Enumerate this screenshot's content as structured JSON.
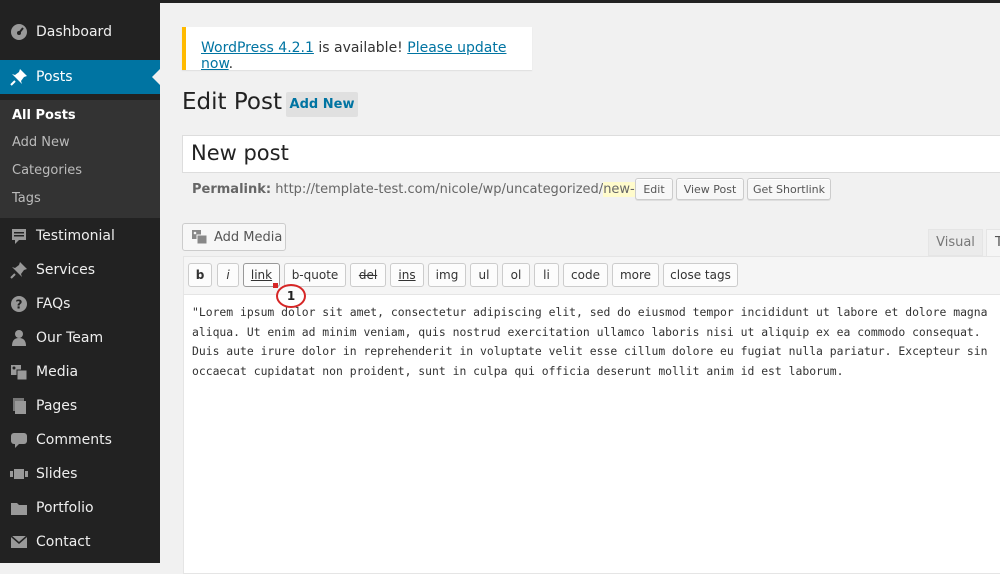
{
  "sidebar": {
    "items": [
      {
        "label": "Dashboard",
        "icon": "dashboard-icon"
      },
      {
        "label": "Posts",
        "icon": "pin-icon",
        "active": true
      },
      {
        "label": "Testimonial",
        "icon": "comment-alt-icon"
      },
      {
        "label": "Services",
        "icon": "pin-icon"
      },
      {
        "label": "FAQs",
        "icon": "help-icon"
      },
      {
        "label": "Our Team",
        "icon": "person-icon"
      },
      {
        "label": "Media",
        "icon": "media-icon"
      },
      {
        "label": "Pages",
        "icon": "pages-icon"
      },
      {
        "label": "Comments",
        "icon": "comment-icon"
      },
      {
        "label": "Slides",
        "icon": "slides-icon"
      },
      {
        "label": "Portfolio",
        "icon": "folder-icon"
      },
      {
        "label": "Contact",
        "icon": "mail-icon"
      }
    ],
    "submenu": [
      "All Posts",
      "Add New",
      "Categories",
      "Tags"
    ]
  },
  "notice": {
    "link1": "WordPress 4.2.1",
    "middle": " is available! ",
    "link2": "Please update now",
    "end": "."
  },
  "page": {
    "title": "Edit Post",
    "add_new": "Add New"
  },
  "post": {
    "title": "New post",
    "permalink_label": "Permalink:",
    "permalink_base": " http://template-test.com/nicole/wp/uncategorized/",
    "permalink_slug": "new-post",
    "permalink_end": "/",
    "edit_btn": "Edit",
    "view_btn": "View Post",
    "shortlink_btn": "Get Shortlink"
  },
  "editor": {
    "add_media": "Add Media",
    "tab_visual": "Visual",
    "tab_text": "T",
    "quicktags": [
      "b",
      "i",
      "link",
      "b-quote",
      "del",
      "ins",
      "img",
      "ul",
      "ol",
      "li",
      "code",
      "more",
      "close tags"
    ],
    "content_lines": [
      "\"Lorem ipsum dolor sit amet, consectetur adipiscing elit, sed do eiusmod tempor incididunt ut labore et dolore magna",
      "aliqua. Ut enim ad minim veniam, quis nostrud exercitation ullamco laboris nisi ut aliquip ex ea commodo consequat.",
      "Duis aute irure dolor in reprehenderit in voluptate velit esse cillum dolore eu fugiat nulla pariatur. Excepteur sin",
      "occaecat cupidatat non proident, sunt in culpa qui officia deserunt mollit anim id est laborum."
    ]
  },
  "annotation": {
    "marker": "1"
  },
  "colors": {
    "sidebar_bg": "#222222",
    "accent": "#0074a2",
    "notice_border": "#ffba00",
    "marker_red": "#d62626"
  }
}
